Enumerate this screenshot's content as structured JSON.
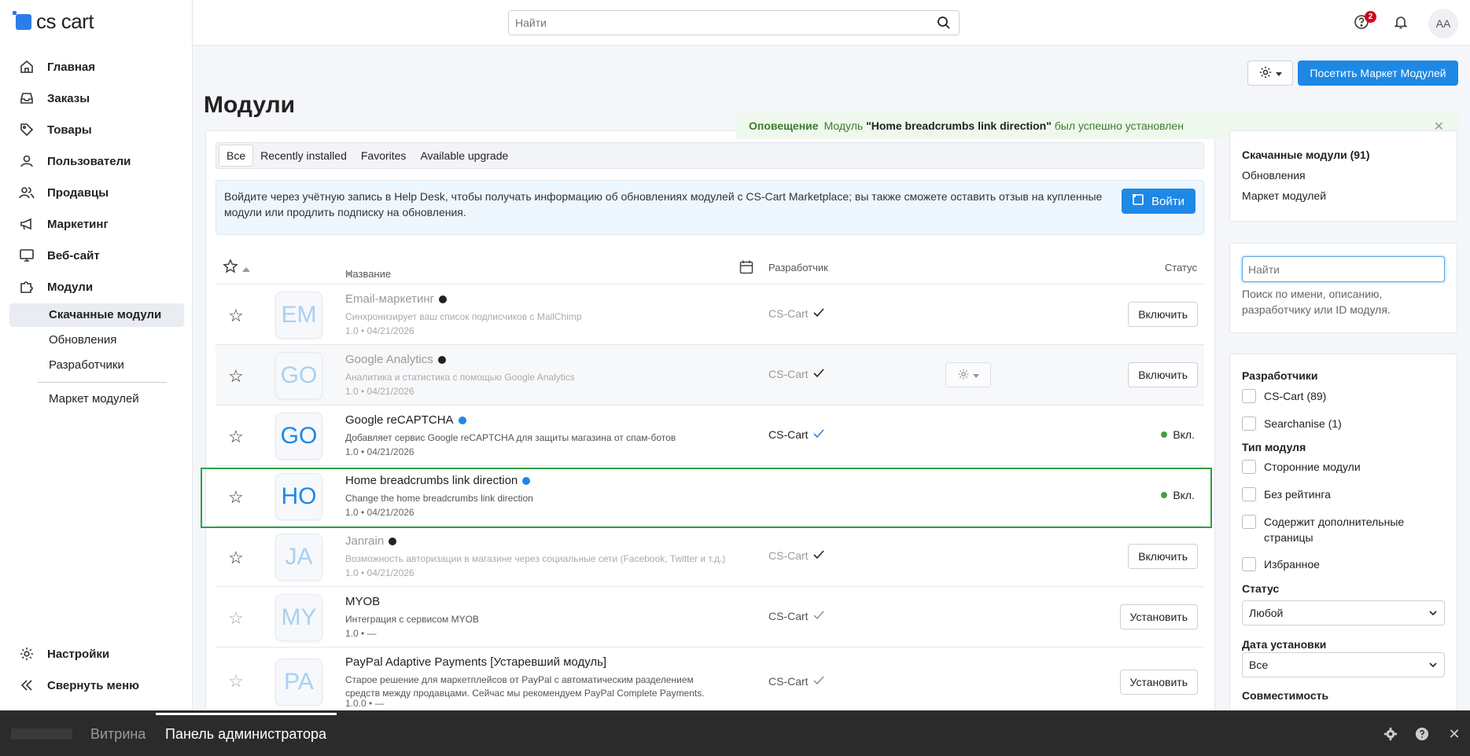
{
  "brand": {
    "name": "cs cart"
  },
  "header": {
    "search_placeholder": "Найти",
    "notifications_count": "2",
    "avatar_initials": "AA"
  },
  "sidebar": {
    "items": [
      {
        "label": "Главная",
        "icon": "home-icon"
      },
      {
        "label": "Заказы",
        "icon": "inbox-icon"
      },
      {
        "label": "Товары",
        "icon": "tag-icon"
      },
      {
        "label": "Пользователи",
        "icon": "user-icon"
      },
      {
        "label": "Продавцы",
        "icon": "users-icon"
      },
      {
        "label": "Маркетинг",
        "icon": "megaphone-icon"
      },
      {
        "label": "Веб-сайт",
        "icon": "monitor-icon"
      },
      {
        "label": "Модули",
        "icon": "puzzle-icon"
      }
    ],
    "subitems": [
      "Скачанные модули",
      "Обновления",
      "Разработчики",
      "Маркет модулей"
    ],
    "settings_label": "Настройки",
    "collapse_label": "Свернуть меню"
  },
  "page": {
    "title": "Модули",
    "visit_market_label": "Посетить Маркет Модулей"
  },
  "alert": {
    "heading": "Оповещение",
    "prefix": "Модуль",
    "module_name": "\"Home breadcrumbs link direction\"",
    "suffix": "был успешно установлен"
  },
  "tabs": [
    "Все",
    "Recently installed",
    "Favorites",
    "Available upgrade"
  ],
  "info": {
    "text": "Войдите через учётную запись в Help Desk, чтобы получать информацию об обновлениях модулей с CS-Cart Marketplace; вы также сможете оставить отзыв на купленные модули или продлить подписку на обновления.",
    "login_label": "Войти"
  },
  "table": {
    "columns": {
      "name": "Название",
      "developer": "Разработчик",
      "status": "Статус"
    },
    "rows": [
      {
        "initials": "EM",
        "name": "Email-маркетинг",
        "desc": "Синхронизирует ваш список подписчиков с MailChimp",
        "ver": "1.0 • 04/21/2026",
        "dev": "CS-Cart",
        "action": "Включить",
        "dot": "#222222"
      },
      {
        "initials": "GO",
        "name": "Google Analytics",
        "desc": "Аналитика и статистика с помощью Google Analytics",
        "ver": "1.0 • 04/21/2026",
        "dev": "CS-Cart",
        "action": "Включить",
        "dot": "#222222"
      },
      {
        "initials": "GO",
        "name": "Google reCAPTCHA",
        "desc": "Добавляет сервис Google reCAPTCHA для защиты магазина от спам-ботов",
        "ver": "1.0 • 04/21/2026",
        "dev": "CS-Cart",
        "status": "Вкл.",
        "dot": "#1e88e5"
      },
      {
        "initials": "HO",
        "name": "Home breadcrumbs link direction",
        "desc": "Change the home breadcrumbs link direction",
        "ver": "1.0 • 04/21/2026",
        "dev": "",
        "status": "Вкл.",
        "dot": "#1e88e5"
      },
      {
        "initials": "JA",
        "name": "Janrain",
        "desc": "Возможность авторизации в магазине через социальные сети (Facebook, Twitter и т.д.)",
        "ver": "1.0 • 04/21/2026",
        "dev": "CS-Cart",
        "action": "Включить",
        "dot": "#222222"
      },
      {
        "initials": "MY",
        "name": "MYOB",
        "desc": "Интеграция с сервисом MYOB",
        "ver": "1.0 • —",
        "dev": "CS-Cart",
        "action": "Установить"
      },
      {
        "initials": "PA",
        "name": "PayPal Adaptive Payments [Устаревший модуль]",
        "desc": "Старое решение для маркетплейсов от PayPal с автоматическим разделением средств между продавцами. Сейчас мы рекомендуем PayPal Complete Payments.",
        "ver": "1.0.0 • —",
        "dev": "CS-Cart",
        "action": "Установить"
      }
    ]
  },
  "side": {
    "links": [
      "Скачанные модули (91)",
      "Обновления",
      "Маркет модулей"
    ],
    "search_placeholder": "Найти",
    "search_hint": "Поиск по имени, описанию, разработчику или ID модуля.",
    "developers_head": "Разработчики",
    "developers": [
      "CS-Cart (89)",
      "Searchanise (1)"
    ],
    "type_head": "Тип модуля",
    "types": [
      "Сторонние модули",
      "Без рейтинга",
      "Содержит дополнительные страницы",
      "Избранное"
    ],
    "status_head": "Статус",
    "status_value": "Любой",
    "date_head": "Дата установки",
    "date_value": "Все",
    "compat_head": "Совместимость"
  },
  "bottom": {
    "storefront": "Витрина",
    "admin": "Панель администратора"
  },
  "colors": {
    "accent": "#1e88e5",
    "success": "#43a047",
    "highlight": "#2ea043"
  }
}
